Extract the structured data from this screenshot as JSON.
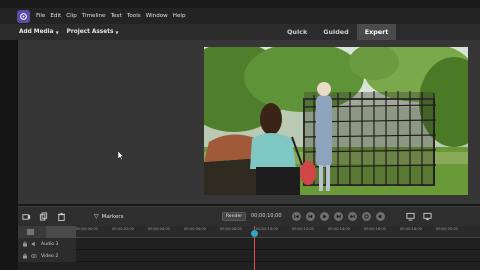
{
  "menu": {
    "items": [
      "File",
      "Edit",
      "Clip",
      "Timeline",
      "Text",
      "Tools",
      "Window",
      "Help"
    ]
  },
  "toolbar": {
    "add_media": "Add Media",
    "project_assets": "Project Assets",
    "tabs": [
      "Quick",
      "Guided",
      "Expert"
    ],
    "active_tab": "Expert"
  },
  "controls": {
    "markers_label": "Markers",
    "render_label": "Render",
    "timecode": "00;00;10;00"
  },
  "timeline": {
    "tick_labels": [
      "00;00;00;00",
      "00;00;02;00",
      "00;00;04;00",
      "00;00;06;00",
      "00;00;08;00",
      "00;00;10;00",
      "00;00;12;00",
      "00;00;14;00",
      "00;00;16;00",
      "00;00;18;00",
      "00;00;20;00"
    ],
    "tracks": [
      {
        "name": "Audio 3"
      },
      {
        "name": "Video 2"
      }
    ]
  },
  "colors": {
    "accent": "#5b4ba8",
    "playhead": "#2fa3c2",
    "playhead_line": "#e05050"
  }
}
